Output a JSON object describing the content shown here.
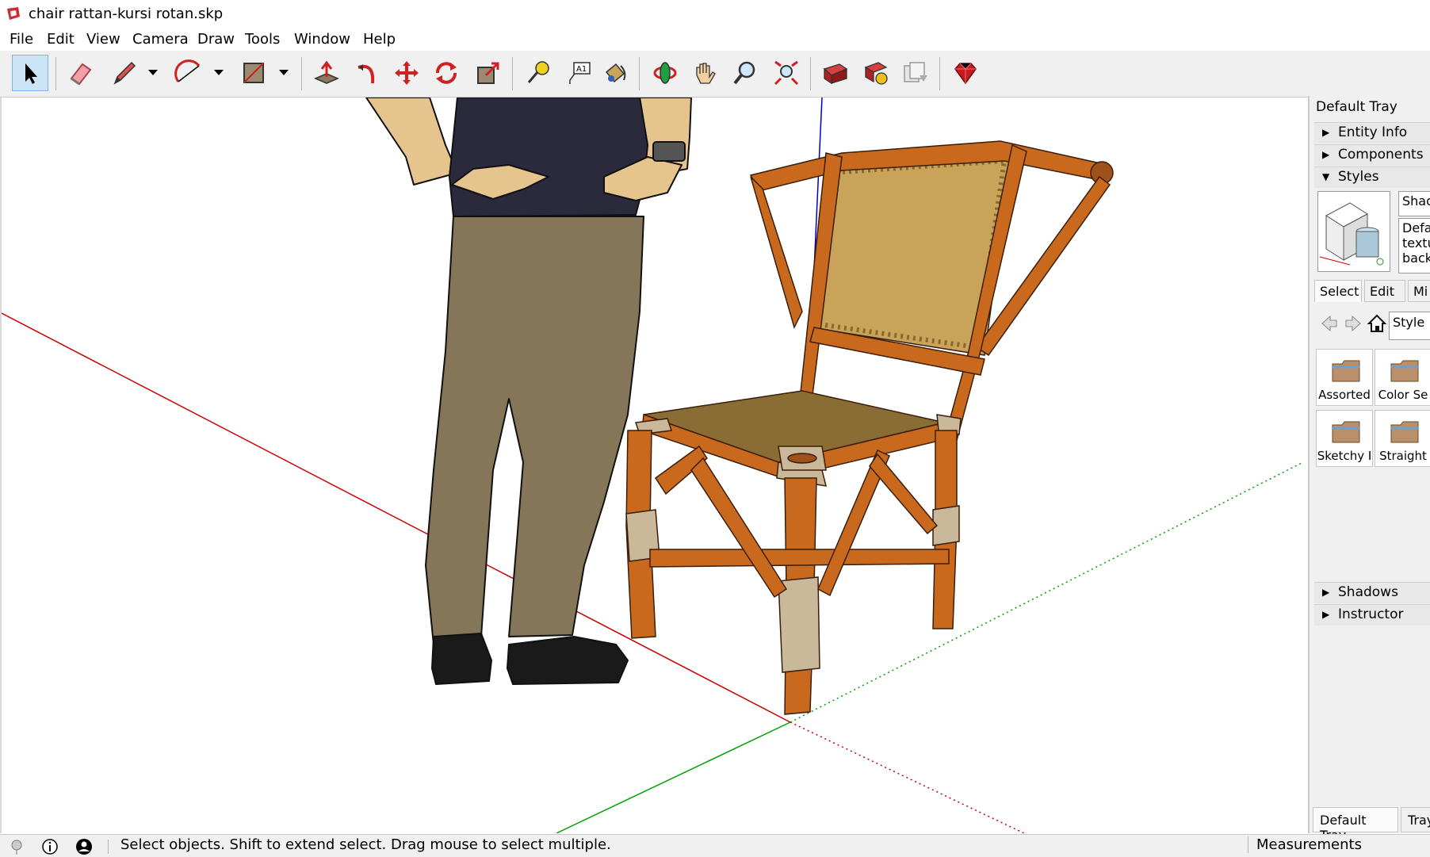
{
  "window": {
    "title": "chair rattan-kursi rotan.skp"
  },
  "menu": [
    "File",
    "Edit",
    "View",
    "Camera",
    "Draw",
    "Tools",
    "Window",
    "Help"
  ],
  "toolbar": {
    "tools": [
      "select-icon",
      "eraser-icon",
      "pencil-icon",
      "arc-icon",
      "rectangle-icon",
      "push-pull-icon",
      "follow-me-icon",
      "move-icon",
      "rotate-icon",
      "scale-icon",
      "tape-measure-icon",
      "text-icon",
      "paint-bucket-icon",
      "orbit-icon",
      "pan-icon",
      "zoom-icon",
      "zoom-extents-icon",
      "warehouse-icon",
      "extension-warehouse-icon",
      "layout-icon",
      "ruby-console-icon"
    ],
    "active_tool": "select-icon"
  },
  "tray": {
    "title": "Default Tray",
    "panels": {
      "entity_info": "Entity Info",
      "components": "Components",
      "styles": "Styles",
      "shadows": "Shadows",
      "instructor": "Instructor"
    },
    "style_name": "Shad",
    "style_desc": [
      "Defa",
      "textu",
      "backo"
    ],
    "tabs": [
      "Select",
      "Edit",
      "Mi"
    ],
    "search_value": "Style",
    "library": [
      "Assorted",
      "Color Se",
      "Sketchy I",
      "Straight"
    ],
    "bottom_tabs": [
      "Default Tray",
      "Tray"
    ]
  },
  "status": {
    "hint": "Select objects. Shift to extend select. Drag mouse to select multiple.",
    "measurements_label": "Measurements"
  },
  "colors": {
    "accent_blue": "#cde4f7",
    "axis_red": "#cc0000",
    "axis_green": "#00a000",
    "axis_blue": "#0000cc",
    "rattan_orange": "#c8691e",
    "wrap_beige": "#c9b89a",
    "weave_tan": "#c9a35a",
    "pants_khaki": "#857559",
    "shirt_navy": "#2a2a3c"
  }
}
